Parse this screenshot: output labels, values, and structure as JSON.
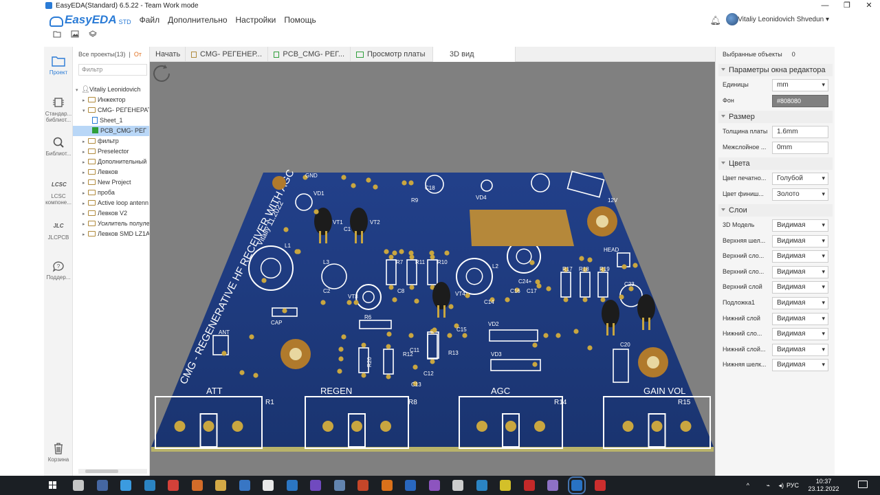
{
  "window": {
    "title": "EasyEDA(Standard) 6.5.22 - Team Work mode",
    "controls": [
      "—",
      "❐",
      "✕"
    ]
  },
  "app": {
    "logo_text": "EasyEDA",
    "logo_suffix": "STD"
  },
  "menu": {
    "items": [
      "Файл",
      "Дополнительно",
      "Настройки",
      "Помощь"
    ]
  },
  "user": {
    "name": "Vitaliy Leonidovich Shvedun ▾"
  },
  "sidebar": {
    "items": [
      {
        "label": "Проект",
        "icon": "folder-icon"
      },
      {
        "label": "Стандар... библиот...",
        "icon": "chip-icon"
      },
      {
        "label": "Библиот...",
        "icon": "search-icon"
      },
      {
        "label": "LCSC компоне...",
        "icon": "lcsc-icon"
      },
      {
        "label": "JLCPCB",
        "icon": "jlc-icon"
      },
      {
        "label": "Поддер...",
        "icon": "help-icon"
      },
      {
        "label": "Корзина",
        "icon": "trash-icon"
      }
    ]
  },
  "tree": {
    "all_projects": "Все проекты(13)",
    "separator": "|",
    "other": "От",
    "filter_placeholder": "Фильтр",
    "owner": "Vitaliy Leonidovich",
    "rows": [
      {
        "label": "Инжектор",
        "type": "folder"
      },
      {
        "label": "CMG- РЕГЕНЕРАТ",
        "type": "folder-open"
      },
      {
        "label": "Sheet_1",
        "type": "sheet"
      },
      {
        "label": "PCB_CMG- РЕГ",
        "type": "pcb"
      },
      {
        "label": "фильтр",
        "type": "folder"
      },
      {
        "label": "Preselector",
        "type": "folder"
      },
      {
        "label": "Дополнительный",
        "type": "folder"
      },
      {
        "label": "Левков",
        "type": "folder"
      },
      {
        "label": "New Project",
        "type": "folder"
      },
      {
        "label": "проба",
        "type": "folder"
      },
      {
        "label": "Active loop antenn",
        "type": "folder"
      },
      {
        "label": "Левков V2",
        "type": "folder"
      },
      {
        "label": "Усилитель полуле",
        "type": "folder"
      },
      {
        "label": "Левков SMD LZ1A",
        "type": "folder"
      }
    ]
  },
  "tabs": [
    {
      "label": "Начать",
      "icon": ""
    },
    {
      "label": "CMG- РЕГЕНЕР...",
      "icon": "sch"
    },
    {
      "label": "PCB_CMG- РЕГ...",
      "icon": "pcb"
    },
    {
      "label": "Просмотр платы",
      "icon": "pcb"
    },
    {
      "label": "3D вид",
      "icon": ""
    }
  ],
  "board": {
    "title": "CMG - REGENERATIVE HF RECEIVER WITH AGC",
    "author": "Vitaliy 11.2022",
    "knobs": [
      "ATT",
      "REGEN",
      "AGC",
      "GAIN VOL"
    ],
    "pots": [
      "R1",
      "R8",
      "R14",
      "R15"
    ],
    "labels": [
      "VD1",
      "VD4",
      "L1",
      "L2",
      "L3",
      "C1",
      "C2",
      "C8",
      "C11",
      "C12",
      "C13",
      "C14",
      "C15",
      "C16",
      "C17",
      "C20",
      "C23",
      "C24+",
      "R6",
      "R7",
      "R10",
      "R11",
      "R12",
      "R13",
      "R17",
      "R18",
      "R19",
      "R20",
      "VT1",
      "VT2",
      "VT3",
      "VT4",
      "VD2",
      "VD3",
      "CAP",
      "ANT",
      "HEAD",
      "12V",
      "GND",
      "R9",
      "C18"
    ]
  },
  "props": {
    "selected_label": "Выбранные объекты",
    "selected_count": "0",
    "sections": {
      "editor": "Параметры окна редактора",
      "size": "Размер",
      "colors": "Цвета",
      "layers": "Слои"
    },
    "units_label": "Единицы",
    "units_value": "mm",
    "bg_label": "Фон",
    "bg_value": "#808080",
    "thickness_label": "Толщина платы",
    "thickness_value": "1.6mm",
    "interlayer_label": "Межслойное ...",
    "interlayer_value": "0mm",
    "mask_label": "Цвет печатно...",
    "mask_value": "Голубой",
    "finish_label": "Цвет финиш...",
    "finish_value": "Золото",
    "layers": [
      {
        "label": "3D Модель",
        "value": "Видимая"
      },
      {
        "label": "Верхняя шел...",
        "value": "Видимая"
      },
      {
        "label": "Верхний сло...",
        "value": "Видимая"
      },
      {
        "label": "Верхний сло...",
        "value": "Видимая"
      },
      {
        "label": "Верхний слой",
        "value": "Видимая"
      },
      {
        "label": "Подложка1",
        "value": "Видимая"
      },
      {
        "label": "Нижний слой",
        "value": "Видимая"
      },
      {
        "label": "Нижний сло...",
        "value": "Видимая"
      },
      {
        "label": "Нижний слой...",
        "value": "Видимая"
      },
      {
        "label": "Нижняя шелк...",
        "value": "Видимая"
      }
    ]
  },
  "taskbar": {
    "lang": "РУС",
    "time": "10:37",
    "date": "23.12.2022"
  },
  "colors": {
    "accent": "#2a7bd6",
    "board": "#1e3a7a",
    "pad": "#c9a640",
    "viewport_bg": "#808080"
  }
}
